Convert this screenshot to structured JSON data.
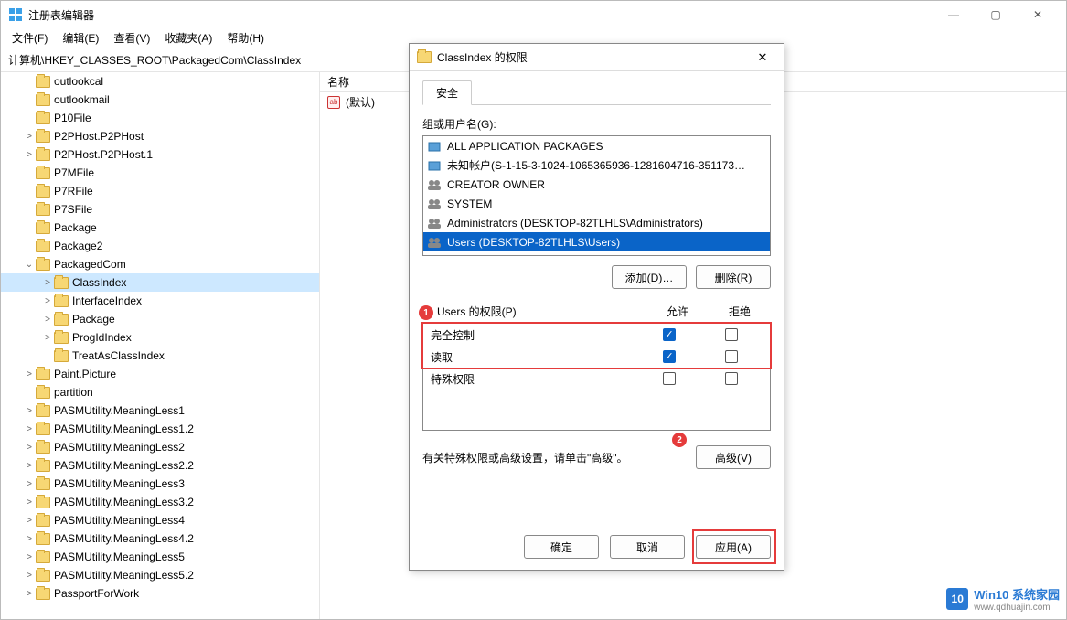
{
  "app": {
    "title": "注册表编辑器"
  },
  "win_controls": {
    "min": "—",
    "max": "▢",
    "close": "✕"
  },
  "menu": {
    "file": "文件(F)",
    "edit": "编辑(E)",
    "view": "查看(V)",
    "fav": "收藏夹(A)",
    "help": "帮助(H)"
  },
  "address": "计算机\\HKEY_CLASSES_ROOT\\PackagedCom\\ClassIndex",
  "tree": {
    "items": [
      {
        "label": "outlookcal",
        "indent": 1,
        "chev": ""
      },
      {
        "label": "outlookmail",
        "indent": 1,
        "chev": ""
      },
      {
        "label": "P10File",
        "indent": 1,
        "chev": ""
      },
      {
        "label": "P2PHost.P2PHost",
        "indent": 1,
        "chev": ">"
      },
      {
        "label": "P2PHost.P2PHost.1",
        "indent": 1,
        "chev": ">"
      },
      {
        "label": "P7MFile",
        "indent": 1,
        "chev": ""
      },
      {
        "label": "P7RFile",
        "indent": 1,
        "chev": ""
      },
      {
        "label": "P7SFile",
        "indent": 1,
        "chev": ""
      },
      {
        "label": "Package",
        "indent": 1,
        "chev": ""
      },
      {
        "label": "Package2",
        "indent": 1,
        "chev": ""
      },
      {
        "label": "PackagedCom",
        "indent": 1,
        "chev": "⌄",
        "expanded": true
      },
      {
        "label": "ClassIndex",
        "indent": 2,
        "chev": ">",
        "selected": true
      },
      {
        "label": "InterfaceIndex",
        "indent": 2,
        "chev": ">"
      },
      {
        "label": "Package",
        "indent": 2,
        "chev": ">"
      },
      {
        "label": "ProgIdIndex",
        "indent": 2,
        "chev": ">"
      },
      {
        "label": "TreatAsClassIndex",
        "indent": 2,
        "chev": ""
      },
      {
        "label": "Paint.Picture",
        "indent": 1,
        "chev": ">"
      },
      {
        "label": "partition",
        "indent": 1,
        "chev": ""
      },
      {
        "label": "PASMUtility.MeaningLess1",
        "indent": 1,
        "chev": ">"
      },
      {
        "label": "PASMUtility.MeaningLess1.2",
        "indent": 1,
        "chev": ">"
      },
      {
        "label": "PASMUtility.MeaningLess2",
        "indent": 1,
        "chev": ">"
      },
      {
        "label": "PASMUtility.MeaningLess2.2",
        "indent": 1,
        "chev": ">"
      },
      {
        "label": "PASMUtility.MeaningLess3",
        "indent": 1,
        "chev": ">"
      },
      {
        "label": "PASMUtility.MeaningLess3.2",
        "indent": 1,
        "chev": ">"
      },
      {
        "label": "PASMUtility.MeaningLess4",
        "indent": 1,
        "chev": ">"
      },
      {
        "label": "PASMUtility.MeaningLess4.2",
        "indent": 1,
        "chev": ">"
      },
      {
        "label": "PASMUtility.MeaningLess5",
        "indent": 1,
        "chev": ">"
      },
      {
        "label": "PASMUtility.MeaningLess5.2",
        "indent": 1,
        "chev": ">"
      },
      {
        "label": "PassportForWork",
        "indent": 1,
        "chev": ">"
      }
    ]
  },
  "detail": {
    "header_name": "名称",
    "default_value": "(默认)"
  },
  "dialog": {
    "title": "ClassIndex 的权限",
    "tab": "安全",
    "group_label": "组或用户名(G):",
    "principals": [
      {
        "label": "ALL APPLICATION PACKAGES",
        "type": "pkg"
      },
      {
        "label": "未知帐户(S-1-15-3-1024-1065365936-1281604716-351173…",
        "type": "pkg"
      },
      {
        "label": "CREATOR OWNER",
        "type": "group"
      },
      {
        "label": "SYSTEM",
        "type": "group"
      },
      {
        "label": "Administrators (DESKTOP-82TLHLS\\Administrators)",
        "type": "group"
      },
      {
        "label": "Users (DESKTOP-82TLHLS\\Users)",
        "type": "group",
        "selected": true
      }
    ],
    "add_btn": "添加(D)…",
    "remove_btn": "删除(R)",
    "perm_label": "Users 的权限(P)",
    "col_allow": "允许",
    "col_deny": "拒绝",
    "perms": [
      {
        "label": "完全控制",
        "allow": true,
        "deny": false
      },
      {
        "label": "读取",
        "allow": true,
        "deny": false
      },
      {
        "label": "特殊权限",
        "allow": false,
        "deny": false
      }
    ],
    "adv_text": "有关特殊权限或高级设置，请单击\"高级\"。",
    "adv_btn": "高级(V)",
    "ok_btn": "确定",
    "cancel_btn": "取消",
    "apply_btn": "应用(A)",
    "badge1": "1",
    "badge2": "2"
  },
  "watermark": {
    "brand": "Win10 系统家园",
    "url": "www.qdhuajin.com",
    "logo": "10"
  }
}
